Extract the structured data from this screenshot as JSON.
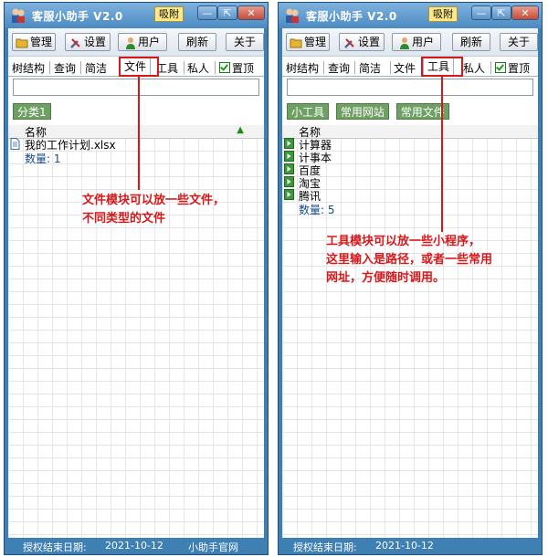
{
  "title": "客服小助手 V2.0",
  "pin_label": "吸附",
  "window_controls": {
    "minimize": "—",
    "restore": "⇱",
    "close": "✕"
  },
  "toolbar": {
    "manage": "管理",
    "settings": "设置",
    "user": "用户",
    "refresh": "刷新",
    "about": "关于"
  },
  "tabs": [
    "树结构",
    "查询",
    "简洁",
    "文件",
    "工具",
    "私人"
  ],
  "topmost_label": "置顶",
  "search": {
    "value": "",
    "placeholder": ""
  },
  "left_panel": {
    "active_tab": "文件",
    "categories": [
      "分类1"
    ],
    "column_header": "名称",
    "items": [
      "我的工作计划.xlsx"
    ],
    "count_label": "数量: 1"
  },
  "right_panel": {
    "active_tab": "工具",
    "categories": [
      "小工具",
      "常用网站",
      "常用文件"
    ],
    "column_header": "名称",
    "items": [
      "计算器",
      "计事本",
      "百度",
      "淘宝",
      "腾讯"
    ],
    "count_label": "数量: 5"
  },
  "status": {
    "auth_label": "授权结束日期:",
    "auth_date": "2021-10-12",
    "site": "小助手官网"
  },
  "annotations": {
    "left_line1": "文件模块可以放一些文件，",
    "left_line2": "不同类型的文件",
    "right_line1": "工具模块可以放一些小程序，",
    "right_line2": "这里输入是路径，或者一些常用",
    "right_line3": "网址，方便随时调用。"
  },
  "colors": {
    "window": "#3e7fb4",
    "category": "#6fa063",
    "annotation": "#d6181a"
  }
}
